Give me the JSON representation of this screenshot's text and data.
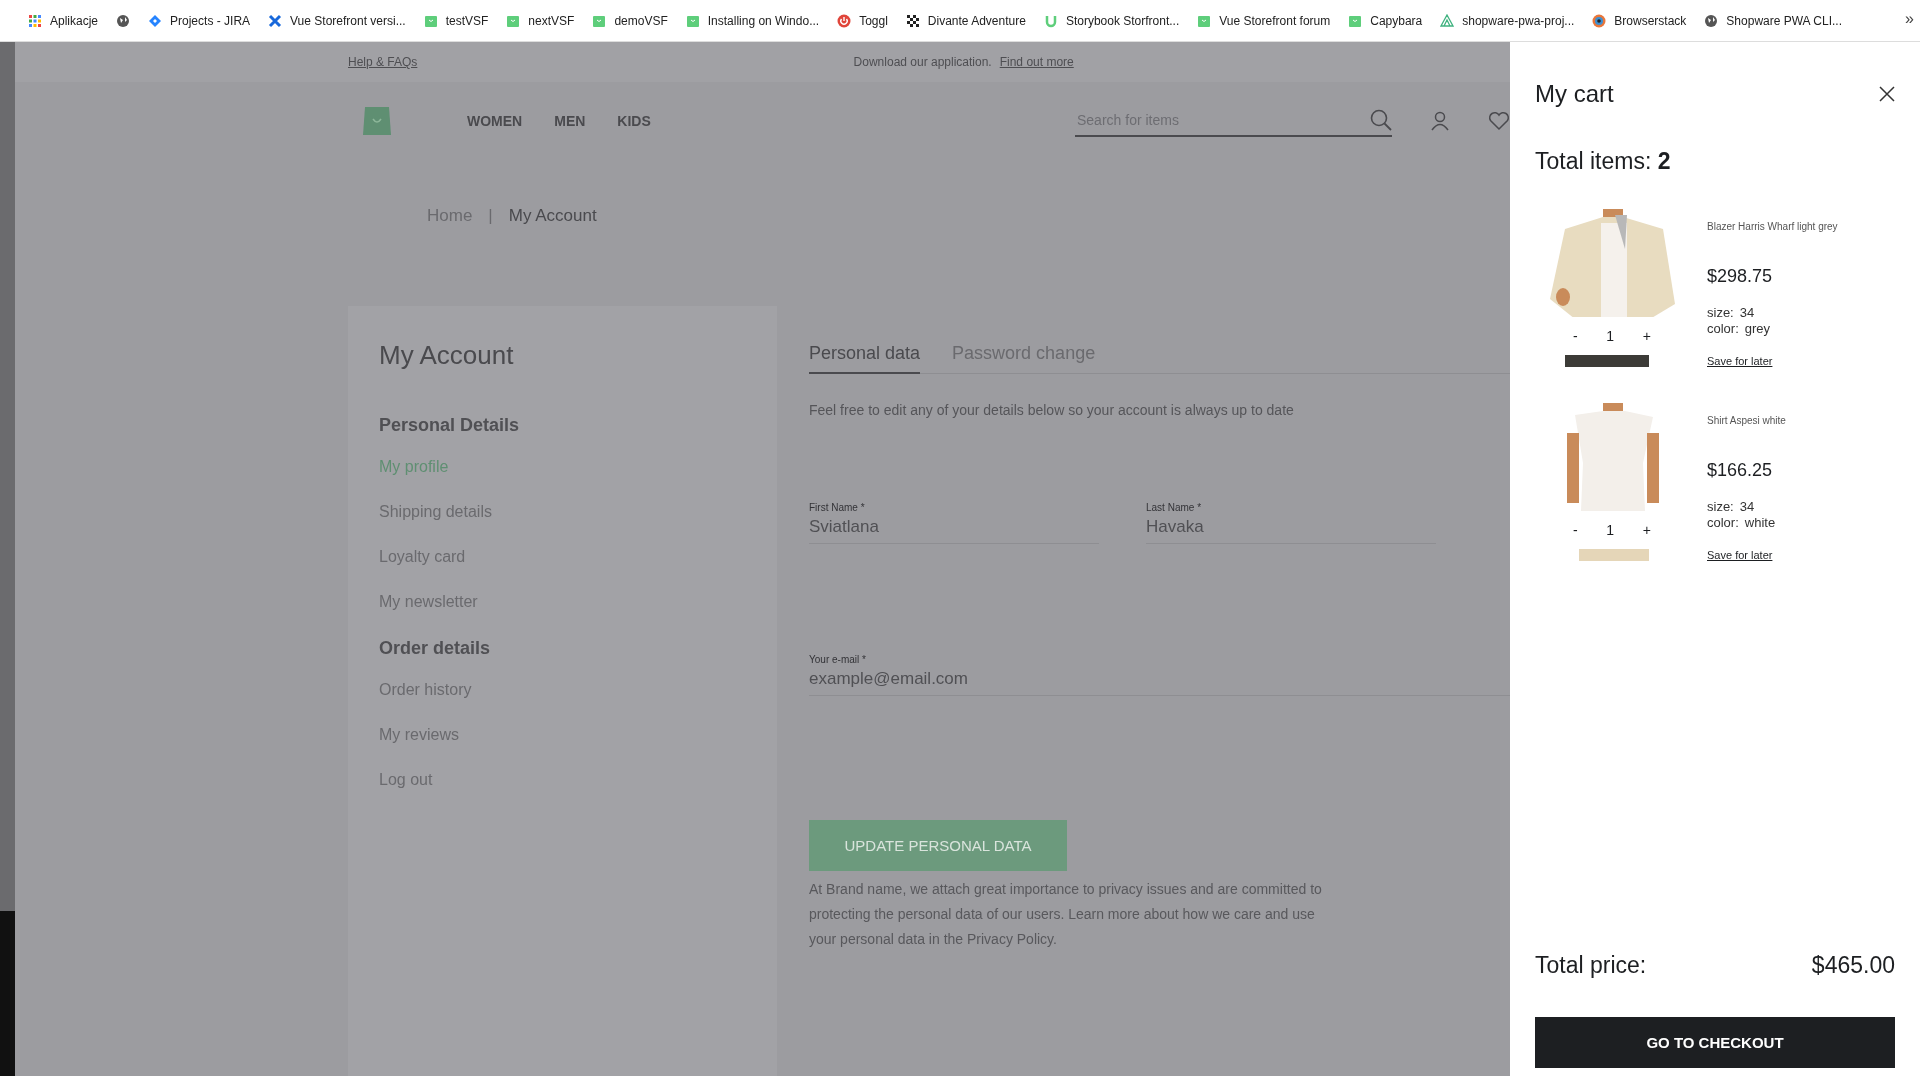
{
  "bookmarks": [
    {
      "label": "Aplikacje",
      "kind": "grid"
    },
    {
      "kind": "globe"
    },
    {
      "label": "Projects - JIRA",
      "kind": "diamond"
    },
    {
      "label": "Vue Storefront versi...",
      "kind": "cross"
    },
    {
      "label": "testVSF",
      "kind": "bag"
    },
    {
      "label": "nextVSF",
      "kind": "bag"
    },
    {
      "label": "demoVSF",
      "kind": "bag"
    },
    {
      "label": "Installing on Windo...",
      "kind": "bag"
    },
    {
      "label": "Toggl",
      "kind": "power"
    },
    {
      "label": "Divante Adventure",
      "kind": "checker"
    },
    {
      "label": "Storybook Storfront...",
      "kind": "u"
    },
    {
      "label": "Vue Storefront forum",
      "kind": "bag"
    },
    {
      "label": "Capybara",
      "kind": "bag"
    },
    {
      "label": "shopware-pwa-proj...",
      "kind": "triangle"
    },
    {
      "label": "Browserstack",
      "kind": "eye"
    },
    {
      "label": "Shopware PWA CLI...",
      "kind": "globe"
    }
  ],
  "bookmarks_overflow": "»",
  "top_bar": {
    "help_link": "Help & FAQs",
    "download_text": "Download our application.",
    "find_out_link": "Find out more"
  },
  "header": {
    "nav": [
      {
        "label": "WOMEN"
      },
      {
        "label": "MEN"
      },
      {
        "label": "KIDS"
      }
    ],
    "search": {
      "placeholder": "Search for items"
    }
  },
  "breadcrumb": [
    {
      "label": "Home",
      "selected": false
    },
    {
      "label": "|",
      "selected": false
    },
    {
      "label": "My Account",
      "selected": true
    }
  ],
  "sidebar": {
    "title": "My Account",
    "sections": [
      {
        "heading": "Personal Details",
        "items": [
          {
            "label": "My profile",
            "selected": true
          },
          {
            "label": "Shipping details",
            "selected": false
          },
          {
            "label": "Loyalty card",
            "selected": false
          },
          {
            "label": "My newsletter",
            "selected": false
          }
        ]
      },
      {
        "heading": "Order details",
        "items": [
          {
            "label": "Order history",
            "selected": false
          },
          {
            "label": "My reviews",
            "selected": false
          },
          {
            "label": "Log out",
            "selected": false
          }
        ]
      }
    ]
  },
  "tabs": [
    {
      "label": "Personal data",
      "selected": true
    },
    {
      "label": "Password change",
      "selected": false
    }
  ],
  "description": "Feel free to edit any of your details below so your account is always up to date",
  "fields": [
    {
      "label": "First Name *",
      "value": "Sviatlana"
    },
    {
      "label": "Last Name *",
      "value": "Havaka"
    },
    {
      "label": "Your e-mail *",
      "value": "example@email.com"
    }
  ],
  "update_button": "UPDATE PERSONAL DATA",
  "privacy_text": "At Brand name, we attach great importance to privacy issues and are committed to protecting the personal data of our users. Learn more about how we care and use your personal data in the Privacy Policy.",
  "cart": {
    "title": "My cart",
    "total_items": "Total items: **2**",
    "items": [
      {
        "name": "Blazer Harris Wharf light grey",
        "price": "$298.75",
        "size_label": "size:",
        "size": "34",
        "color_label": "color:",
        "color_value": "grey",
        "minus": "-",
        "quantity": "1",
        "plus": "+",
        "save": "Save for later",
        "kind": "blazer"
      },
      {
        "name": "Shirt Aspesi white",
        "price": "$166.25",
        "size_label": "size:",
        "size": "34",
        "color_label": "color:",
        "color_value": "white",
        "minus": "-",
        "quantity": "1",
        "plus": "+",
        "save": "Save for later",
        "kind": "shirt"
      }
    ],
    "total_price_label": "Total price:",
    "total_price": "$465.00",
    "checkout": "GO TO CHECKOUT"
  }
}
